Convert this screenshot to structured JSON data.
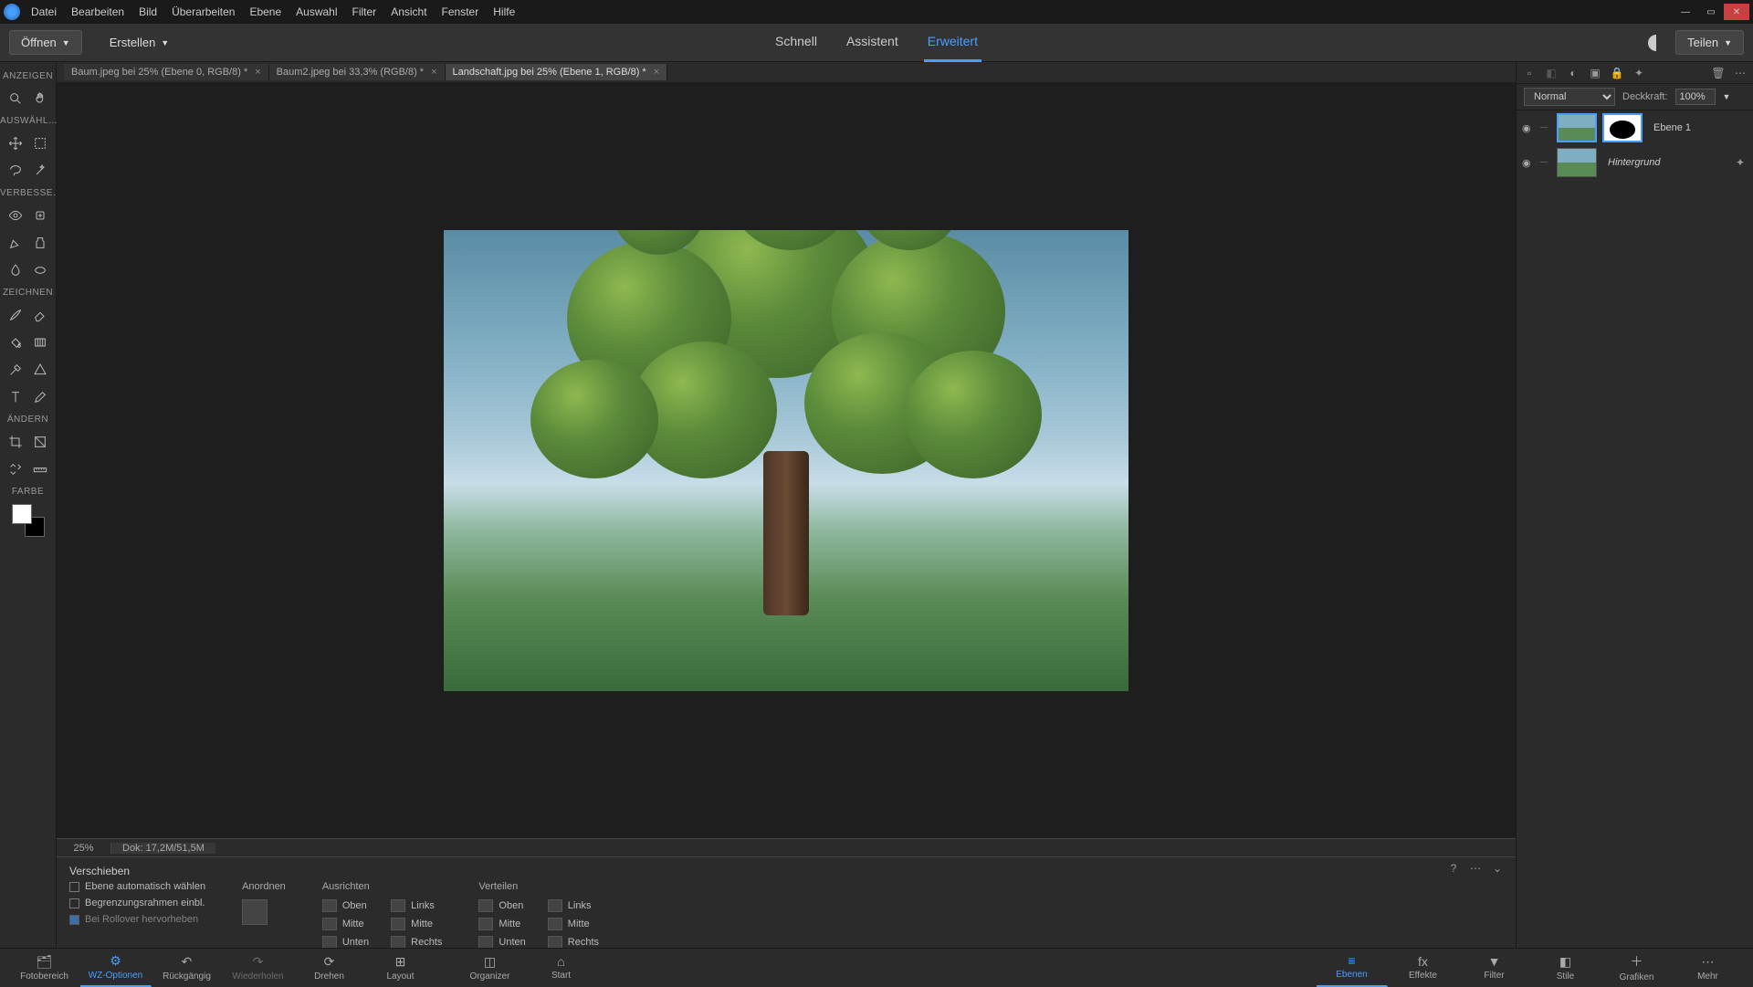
{
  "menu": {
    "items": [
      "Datei",
      "Bearbeiten",
      "Bild",
      "Überarbeiten",
      "Ebene",
      "Auswahl",
      "Filter",
      "Ansicht",
      "Fenster",
      "Hilfe"
    ]
  },
  "toolbar": {
    "open": "Öffnen",
    "create": "Erstellen",
    "share": "Teilen"
  },
  "viewTabs": {
    "quick": "Schnell",
    "guided": "Assistent",
    "expert": "Erweitert"
  },
  "docTabs": [
    {
      "label": "Baum.jpeg bei 25% (Ebene 0, RGB/8) *"
    },
    {
      "label": "Baum2.jpeg bei 33,3% (RGB/8) *"
    },
    {
      "label": "Landschaft.jpg bei 25% (Ebene 1, RGB/8) *",
      "active": true
    }
  ],
  "toolSections": {
    "view": "ANZEIGEN",
    "select": "AUSWÄHL…",
    "enhance": "VERBESSE…",
    "draw": "ZEICHNEN",
    "modify": "ÄNDERN",
    "color": "FARBE"
  },
  "status": {
    "zoom": "25%",
    "docinfo": "Dok: 17,2M/51,5M"
  },
  "options": {
    "title": "Verschieben",
    "autoSelect": "Ebene automatisch wählen",
    "bounding": "Begrenzungsrahmen einbl.",
    "rollover": "Bei Rollover hervorheben",
    "arrange": "Anordnen",
    "align": "Ausrichten",
    "distribute": "Verteilen",
    "top": "Oben",
    "middle": "Mitte",
    "bottom": "Unten",
    "left": "Links",
    "center": "Mitte",
    "right": "Rechts"
  },
  "layers": {
    "blendMode": "Normal",
    "opacityLabel": "Deckkraft:",
    "opacityValue": "100%",
    "items": [
      {
        "name": "Ebene 1",
        "hasMask": true
      },
      {
        "name": "Hintergrund",
        "italic": true
      }
    ]
  },
  "bottom": {
    "photoBin": "Fotobereich",
    "toolOptions": "WZ-Optionen",
    "undo": "Rückgängig",
    "redo": "Wiederholen",
    "rotate": "Drehen",
    "layout": "Layout",
    "organizer": "Organizer",
    "home": "Start",
    "layers": "Ebenen",
    "effects": "Effekte",
    "filter": "Filter",
    "styles": "Stile",
    "graphics": "Grafiken",
    "more": "Mehr"
  }
}
